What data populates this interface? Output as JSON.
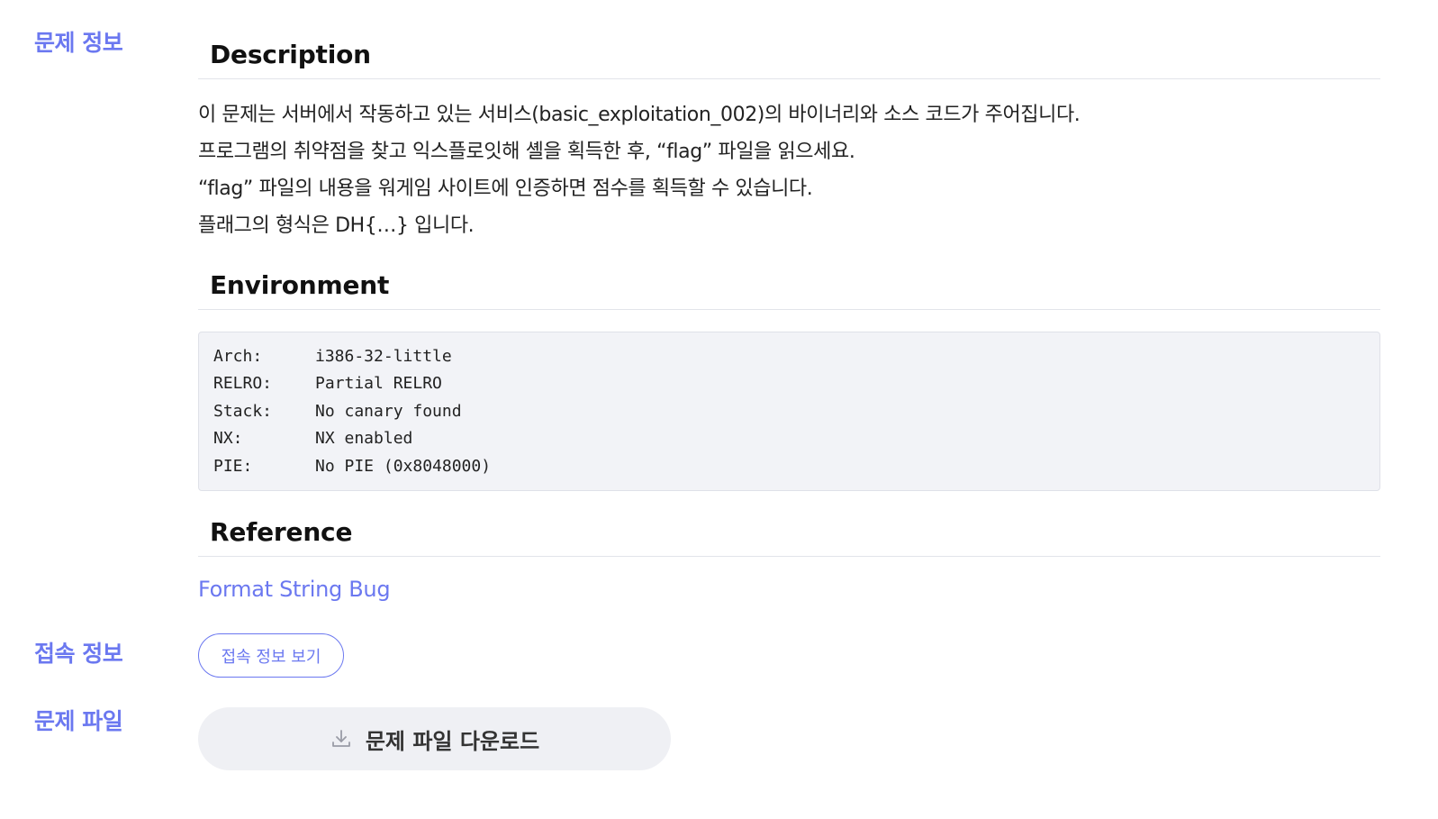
{
  "labels": {
    "problem_info": "문제 정보",
    "connection_info": "접속 정보",
    "problem_file": "문제 파일"
  },
  "description": {
    "heading": "Description",
    "lines": [
      "이 문제는 서버에서 작동하고 있는 서비스(basic_exploitation_002)의 바이너리와 소스 코드가 주어집니다.",
      "프로그램의 취약점을 찾고 익스플로잇해 셸을 획득한 후, “flag” 파일을 읽으세요.",
      "“flag” 파일의 내용을 워게임 사이트에 인증하면 점수를 획득할 수 있습니다.",
      "플래그의 형식은 DH{…} 입니다."
    ]
  },
  "environment": {
    "heading": "Environment",
    "rows": [
      {
        "key": "Arch:",
        "value": "i386-32-little"
      },
      {
        "key": "RELRO:",
        "value": "Partial RELRO"
      },
      {
        "key": "Stack:",
        "value": "No canary found"
      },
      {
        "key": "NX:",
        "value": "NX enabled"
      },
      {
        "key": "PIE:",
        "value": "No PIE (0x8048000)"
      }
    ]
  },
  "reference": {
    "heading": "Reference",
    "link_text": "Format String Bug"
  },
  "connection_button_label": "접속 정보 보기",
  "download_button_label": "문제 파일 다운로드",
  "icons": {
    "download": "download-icon"
  },
  "colors": {
    "accent": "#6b78f0",
    "code_bg": "#f2f3f7",
    "button_bg": "#eff0f4"
  }
}
